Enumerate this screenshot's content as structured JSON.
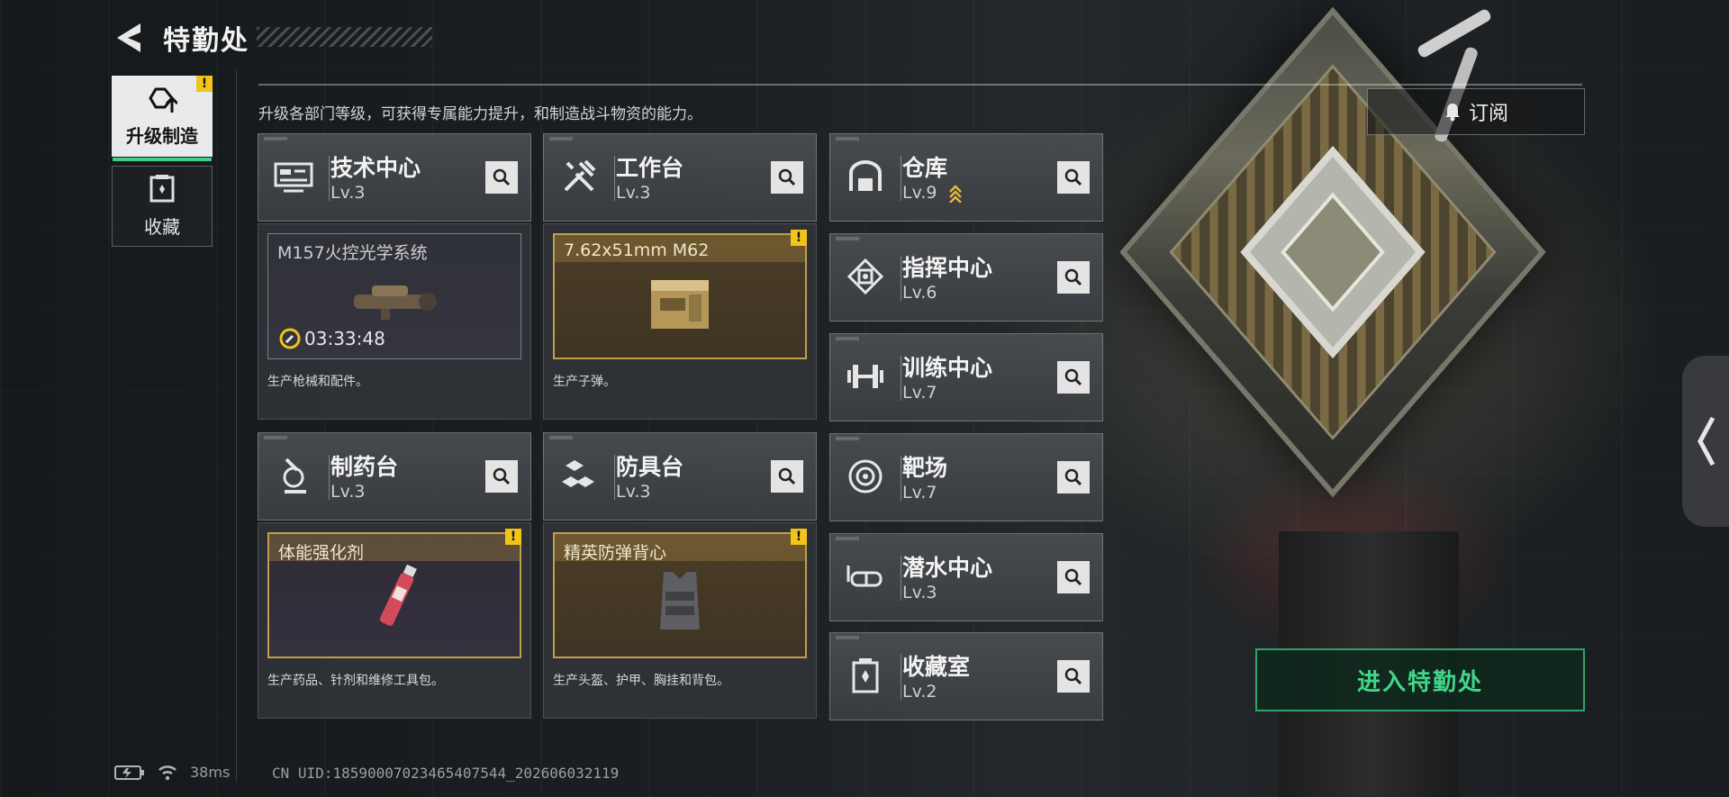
{
  "header": {
    "title": "特勤处"
  },
  "sidebar": {
    "tabs": [
      {
        "label": "升级制造",
        "icon": "upgrade-icon",
        "active": true,
        "alert": "!"
      },
      {
        "label": "收藏",
        "icon": "collection-icon",
        "active": false
      }
    ]
  },
  "description": "升级各部门等级，可获得专属能力提升，和制造战斗物资的能力。",
  "subscribe_label": "订阅",
  "enter_label": "进入特勤处",
  "production": [
    {
      "name": "技术中心",
      "level": "Lv.3",
      "icon": "tech-center-icon",
      "item": "M157火控光学系统",
      "timer": "03:33:48",
      "caption": "生产枪械和配件。",
      "highlight": false,
      "alert": ""
    },
    {
      "name": "工作台",
      "level": "Lv.3",
      "icon": "workbench-icon",
      "item": "7.62x51mm M62",
      "timer": "",
      "caption": "生产子弹。",
      "highlight": true,
      "alert": "!"
    },
    {
      "name": "制药台",
      "level": "Lv.3",
      "icon": "pharmacy-icon",
      "item": "体能强化剂",
      "timer": "",
      "caption": "生产药品、针剂和维修工具包。",
      "highlight": true,
      "alert": "!"
    },
    {
      "name": "防具台",
      "level": "Lv.3",
      "icon": "armor-bench-icon",
      "item": "精英防弹背心",
      "timer": "",
      "caption": "生产头盔、护甲、胸挂和背包。",
      "highlight": true,
      "alert": "!"
    }
  ],
  "departments": [
    {
      "name": "仓库",
      "level": "Lv.9",
      "icon": "warehouse-icon",
      "upgradable": true
    },
    {
      "name": "指挥中心",
      "level": "Lv.6",
      "icon": "command-center-icon",
      "upgradable": false
    },
    {
      "name": "训练中心",
      "level": "Lv.7",
      "icon": "training-center-icon",
      "upgradable": false
    },
    {
      "name": "靶场",
      "level": "Lv.7",
      "icon": "shooting-range-icon",
      "upgradable": false
    },
    {
      "name": "潜水中心",
      "level": "Lv.3",
      "icon": "diving-center-icon",
      "upgradable": false
    },
    {
      "name": "收藏室",
      "level": "Lv.2",
      "icon": "collection-room-icon",
      "upgradable": false
    }
  ],
  "status_bar": {
    "ping": "38ms",
    "uid": "CN UID:18590007023465407544_202606032119"
  },
  "colors": {
    "accent_green": "#3fd082",
    "alert_yellow": "#f0c419",
    "gold_frame": "#c29e4c"
  }
}
